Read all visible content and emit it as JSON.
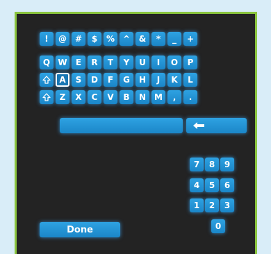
{
  "keyboard": {
    "row1": [
      "!",
      "@",
      "#",
      "$",
      "%",
      "^",
      "&",
      "*",
      "_",
      "+"
    ],
    "row2": [
      "Q",
      "W",
      "E",
      "R",
      "T",
      "Y",
      "U",
      "I",
      "O",
      "P"
    ],
    "row3": [
      "A",
      "S",
      "D",
      "F",
      "G",
      "H",
      "J",
      "K",
      "L"
    ],
    "row4": [
      "Z",
      "X",
      "C",
      "V",
      "B",
      "N",
      "M",
      ",",
      "."
    ],
    "selected_key": "A"
  },
  "numpad": {
    "row1": [
      "7",
      "8",
      "9"
    ],
    "row2": [
      "4",
      "5",
      "6"
    ],
    "row3": [
      "1",
      "2",
      "3"
    ],
    "row4": [
      "0"
    ]
  },
  "done_label": "Done",
  "colors": {
    "key": "#1e90d8",
    "panel": "#232323",
    "border": "#8bc53f",
    "page": "#d9edf8"
  }
}
